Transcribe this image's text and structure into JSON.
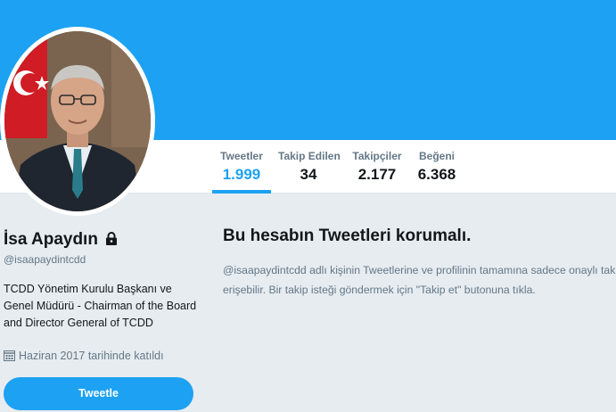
{
  "profile": {
    "name": "İsa Apaydın",
    "handle": "@isaapaydintcdd",
    "bio": "TCDD Yönetim Kurulu Başkanı ve Genel Müdürü - Chairman of the Board and Director General of TCDD",
    "joined": "Haziran 2017 tarihinde katıldı",
    "locked_icon": "lock-icon",
    "joined_icon": "calendar-icon"
  },
  "stats": [
    {
      "label": "Tweetler",
      "value": "1.999",
      "active": true
    },
    {
      "label": "Takip Edilen",
      "value": "34",
      "active": false
    },
    {
      "label": "Takipçiler",
      "value": "2.177",
      "active": false
    },
    {
      "label": "Beğeni",
      "value": "6.368",
      "active": false
    }
  ],
  "actions": {
    "tweet_label": "Tweetle"
  },
  "protected": {
    "title": "Bu hesabın Tweetleri korumalı.",
    "line1": "@isaapaydintcdd adlı kişinin Tweetlerine ve profilinin tamamına sadece onaylı takipçiler",
    "line2": "erişebilir. Bir takip isteği göndermek için \"Takip et\" butonuna tıkla."
  },
  "colors": {
    "accent": "#1da1f2",
    "background": "#e6ecf0",
    "text": "#14171a",
    "muted": "#657786"
  }
}
